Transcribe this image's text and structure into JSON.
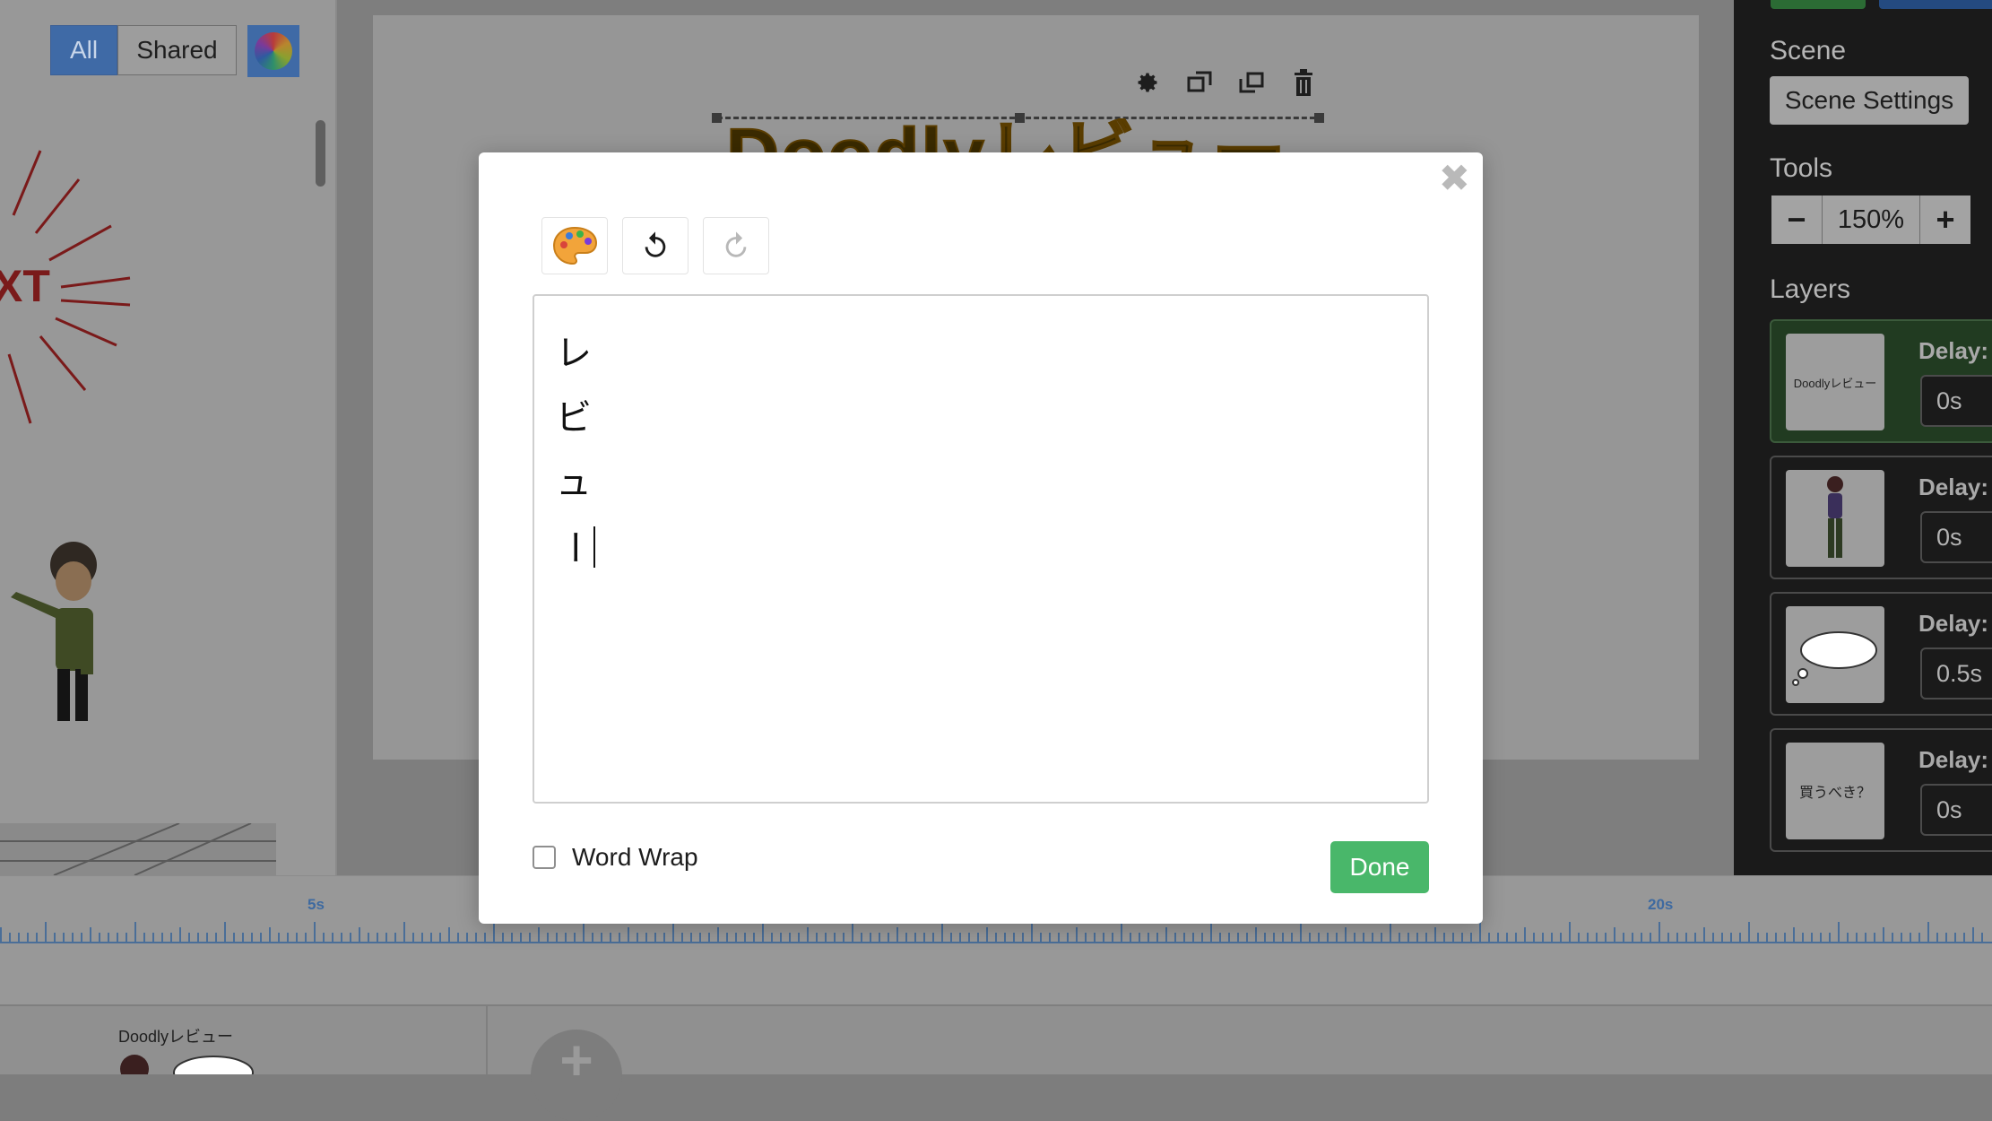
{
  "library": {
    "filter_all": "All",
    "filter_shared": "Shared"
  },
  "canvas": {
    "title_text": "Doodlyレビュー"
  },
  "right_panel": {
    "scene_header": "Scene",
    "scene_settings_label": "Scene Settings",
    "tools_header": "Tools",
    "zoom_minus": "−",
    "zoom_value": "150%",
    "zoom_plus": "+",
    "layers_header": "Layers",
    "layers": [
      {
        "thumb": "Doodlyレビュー",
        "delay_label": "Delay:",
        "delay": "0s",
        "selected": true
      },
      {
        "thumb": "woman-character",
        "delay_label": "Delay:",
        "delay": "0s",
        "selected": false
      },
      {
        "thumb": "thought-bubble",
        "delay_label": "Delay:",
        "delay": "0.5s",
        "selected": false
      },
      {
        "thumb": "買うべき？",
        "delay_label": "Delay:",
        "delay": "0s",
        "selected": false
      }
    ]
  },
  "timeline": {
    "marks": [
      "5s",
      "20s"
    ]
  },
  "scenes": {
    "scene1_title": "Doodlyレビュー"
  },
  "text_editor_modal": {
    "close_symbol": "✖",
    "lines": [
      "レ",
      "ビ",
      "ュ",
      "ー"
    ],
    "word_wrap_label": "Word Wrap",
    "word_wrap_checked": false,
    "done_label": "Done",
    "toolbar": [
      "palette-icon",
      "undo-icon",
      "redo-icon"
    ]
  },
  "colors": {
    "accent_blue": "#3f6aa6",
    "done_green": "#49b76a",
    "timeline_blue": "#4a6e98"
  }
}
